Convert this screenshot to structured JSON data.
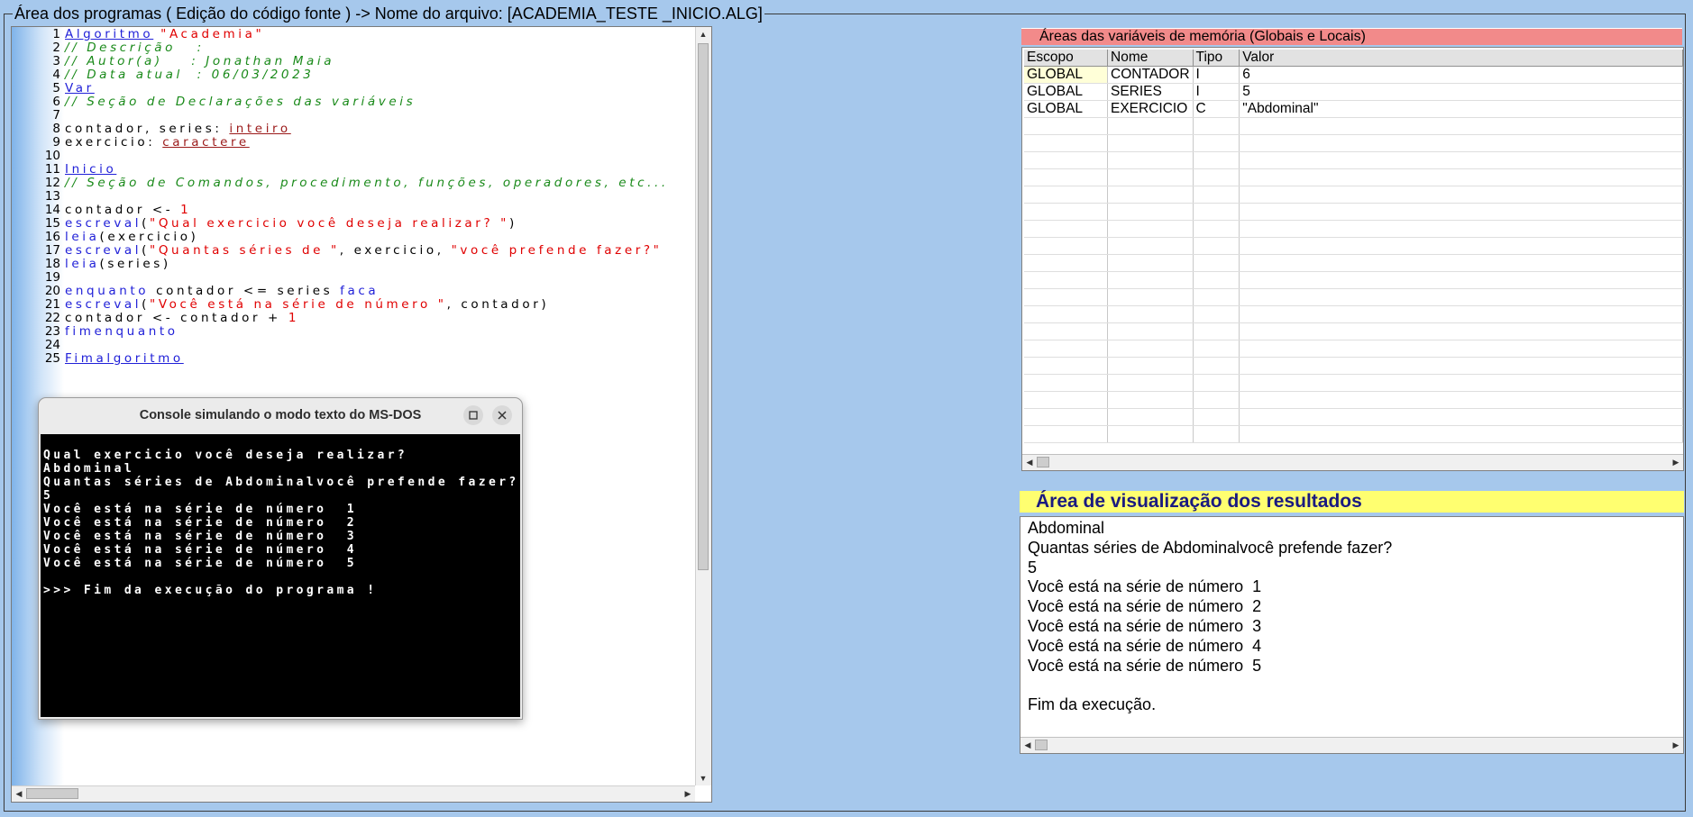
{
  "editor": {
    "title": "Área dos programas ( Edição do código fonte ) -> Nome do arquivo: [ACADEMIA_TESTE _INICIO.ALG]",
    "lines": [
      {
        "n": "1",
        "t": [
          {
            "c": "kwu",
            "s": "Algoritmo"
          },
          {
            "c": "",
            "s": " "
          },
          {
            "c": "str",
            "s": "\"Academia\""
          }
        ]
      },
      {
        "n": "2",
        "t": [
          {
            "c": "cm",
            "s": "// Descrição   :"
          }
        ]
      },
      {
        "n": "3",
        "t": [
          {
            "c": "cm",
            "s": "// Autor(a)    : Jonathan Maia"
          }
        ]
      },
      {
        "n": "4",
        "t": [
          {
            "c": "cm",
            "s": "// Data atual  : 06/03/2023"
          }
        ]
      },
      {
        "n": "5",
        "t": [
          {
            "c": "kwu",
            "s": "Var"
          }
        ]
      },
      {
        "n": "6",
        "t": [
          {
            "c": "cm",
            "s": "// Seção de Declarações das variáveis"
          }
        ]
      },
      {
        "n": "7",
        "t": []
      },
      {
        "n": "8",
        "t": [
          {
            "c": "",
            "s": "contador, series: "
          },
          {
            "c": "typ",
            "s": "inteiro"
          }
        ]
      },
      {
        "n": "9",
        "t": [
          {
            "c": "",
            "s": "exercicio: "
          },
          {
            "c": "typ",
            "s": "caractere"
          }
        ]
      },
      {
        "n": "10",
        "t": []
      },
      {
        "n": "11",
        "t": [
          {
            "c": "kwu",
            "s": "Inicio"
          }
        ]
      },
      {
        "n": "12",
        "t": [
          {
            "c": "cm",
            "s": "// Seção de Comandos, procedimento, funções, operadores, etc..."
          }
        ]
      },
      {
        "n": "13",
        "t": []
      },
      {
        "n": "14",
        "t": [
          {
            "c": "",
            "s": "contador <- "
          },
          {
            "c": "num",
            "s": "1"
          }
        ]
      },
      {
        "n": "15",
        "t": [
          {
            "c": "kw",
            "s": "escreval"
          },
          {
            "c": "",
            "s": "("
          },
          {
            "c": "str",
            "s": "\"Qual exercicio você deseja realizar? \""
          },
          {
            "c": "",
            "s": ")"
          }
        ]
      },
      {
        "n": "16",
        "t": [
          {
            "c": "kw",
            "s": "leia"
          },
          {
            "c": "",
            "s": "(exercicio)"
          }
        ]
      },
      {
        "n": "17",
        "t": [
          {
            "c": "kw",
            "s": "escreval"
          },
          {
            "c": "",
            "s": "("
          },
          {
            "c": "str",
            "s": "\"Quantas séries de \""
          },
          {
            "c": "",
            "s": ", exercicio, "
          },
          {
            "c": "str",
            "s": "\"você prefende fazer?\""
          }
        ]
      },
      {
        "n": "18",
        "t": [
          {
            "c": "kw",
            "s": "leia"
          },
          {
            "c": "",
            "s": "(series)"
          }
        ]
      },
      {
        "n": "19",
        "t": []
      },
      {
        "n": "20",
        "t": [
          {
            "c": "kw",
            "s": "enquanto"
          },
          {
            "c": "",
            "s": " contador <= series "
          },
          {
            "c": "kw",
            "s": "faca"
          }
        ]
      },
      {
        "n": "21",
        "t": [
          {
            "c": "kw",
            "s": "escreval"
          },
          {
            "c": "",
            "s": "("
          },
          {
            "c": "str",
            "s": "\"Você está na série de número \""
          },
          {
            "c": "",
            "s": ", contador)"
          }
        ]
      },
      {
        "n": "22",
        "t": [
          {
            "c": "",
            "s": "contador <- contador + "
          },
          {
            "c": "num",
            "s": "1"
          }
        ]
      },
      {
        "n": "23",
        "t": [
          {
            "c": "kw",
            "s": "fimenquanto"
          }
        ]
      },
      {
        "n": "24",
        "t": []
      },
      {
        "n": "25",
        "t": [
          {
            "c": "kwu",
            "s": "Fimalgoritmo"
          }
        ]
      }
    ]
  },
  "console": {
    "title": "Console simulando o modo texto do MS-DOS",
    "lines": [
      "",
      "Qual exercicio você deseja realizar?",
      "Abdominal",
      "Quantas séries de Abdominalvocê prefende fazer?",
      "5",
      "Você está na série de número  1",
      "Você está na série de número  2",
      "Você está na série de número  3",
      "Você está na série de número  4",
      "Você está na série de número  5",
      "",
      ">>> Fim da execução do programa !"
    ]
  },
  "variables": {
    "title": "Áreas das variáveis de memória (Globais e Locais)",
    "headers": [
      "Escopo",
      "Nome",
      "Tipo",
      "Valor"
    ],
    "rows": [
      [
        "GLOBAL",
        "CONTADOR",
        "I",
        "6"
      ],
      [
        "GLOBAL",
        "SERIES",
        "I",
        "5"
      ],
      [
        "GLOBAL",
        "EXERCICIO",
        "C",
        "\"Abdominal\""
      ]
    ]
  },
  "results": {
    "title": "Área de visualização dos resultados",
    "lines": [
      "Abdominal",
      "Quantas séries de Abdominalvocê prefende fazer?",
      "5",
      "Você está na série de número  1",
      "Você está na série de número  2",
      "Você está na série de número  3",
      "Você está na série de número  4",
      "Você está na série de número  5",
      "",
      "Fim da execução."
    ]
  }
}
